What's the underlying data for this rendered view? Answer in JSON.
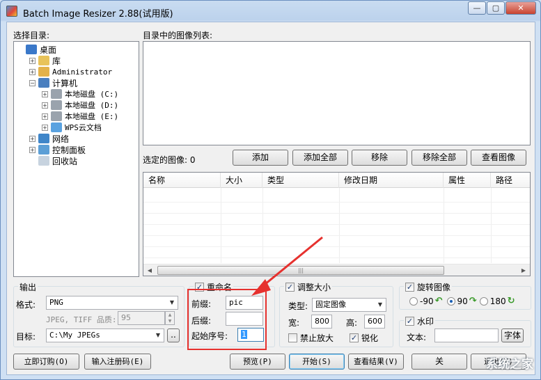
{
  "window": {
    "title": "Batch Image Resizer 2.88(试用版)",
    "buttons": [
      "minimize",
      "maximize",
      "close"
    ]
  },
  "dir_panel": {
    "label": "选择目录:",
    "tree": [
      {
        "label": "桌面",
        "icon": "desktop-icon",
        "expander": ""
      },
      {
        "label": "库",
        "icon": "library-icon",
        "expander": "+"
      },
      {
        "label": "Administrator",
        "icon": "user-folder-icon",
        "expander": "+"
      },
      {
        "label": "计算机",
        "icon": "computer-icon",
        "expander": "−"
      },
      {
        "label": "本地磁盘 (C:)",
        "icon": "drive-icon",
        "expander": "+"
      },
      {
        "label": "本地磁盘 (D:)",
        "icon": "drive-icon",
        "expander": "+"
      },
      {
        "label": "本地磁盘 (E:)",
        "icon": "drive-icon",
        "expander": "+"
      },
      {
        "label": "WPS云文档",
        "icon": "cloud-icon",
        "expander": "+"
      },
      {
        "label": "网络",
        "icon": "network-icon",
        "expander": "+"
      },
      {
        "label": "控制面板",
        "icon": "control-panel-icon",
        "expander": "+"
      },
      {
        "label": "回收站",
        "icon": "recycle-bin-icon",
        "expander": ""
      }
    ]
  },
  "image_list": {
    "label": "目录中的图像列表:"
  },
  "selected": {
    "label": "选定的图像: 0",
    "buttons": {
      "add": "添加",
      "add_all": "添加全部",
      "remove": "移除",
      "remove_all": "移除全部",
      "view": "查看图像"
    },
    "columns": [
      "名称",
      "大小",
      "类型",
      "修改日期",
      "属性",
      "路径"
    ],
    "scroll_grip": "|||"
  },
  "output": {
    "title": "输出",
    "format_label": "格式:",
    "format_value": "PNG",
    "quality_label": "JPEG, TIFF 品质:",
    "quality_value": "95",
    "target_label": "目标:",
    "target_value": "C:\\My JPEGs",
    "browse_label": ".."
  },
  "rename": {
    "title": "重命名",
    "checked": true,
    "prefix_label": "前缀:",
    "prefix_value": "pic",
    "suffix_label": "后缀:",
    "suffix_value": "",
    "start_label": "起始序号:",
    "start_value": "1"
  },
  "resize": {
    "title": "调整大小",
    "checked": true,
    "type_label": "类型:",
    "type_value": "固定图像",
    "width_label": "宽:",
    "width_value": "800",
    "height_label": "高:",
    "height_value": "600",
    "no_enlarge_label": "禁止放大",
    "no_enlarge_checked": false,
    "sharpen_label": "锐化",
    "sharpen_checked": true
  },
  "rotate": {
    "title": "旋转图像",
    "checked": true,
    "options": [
      "-90",
      "90",
      "180"
    ],
    "selected": "90"
  },
  "watermark": {
    "title": "水印",
    "checked": true,
    "text_label": "文本:",
    "text_value": "",
    "font_button": "字体"
  },
  "bottom_buttons": {
    "subscribe": "立即订购(O)",
    "register": "输入注册码(E)",
    "preview": "预览(P)",
    "start": "开始(S)",
    "view_results": "查看结果(V)",
    "about": "关",
    "exit": "退出(X)"
  },
  "overlay_watermark": "系统之家",
  "colors": {
    "highlight_box": "#e6312e",
    "title_bar": "#bcd2ec",
    "window_bg": "#f0f0f0"
  }
}
